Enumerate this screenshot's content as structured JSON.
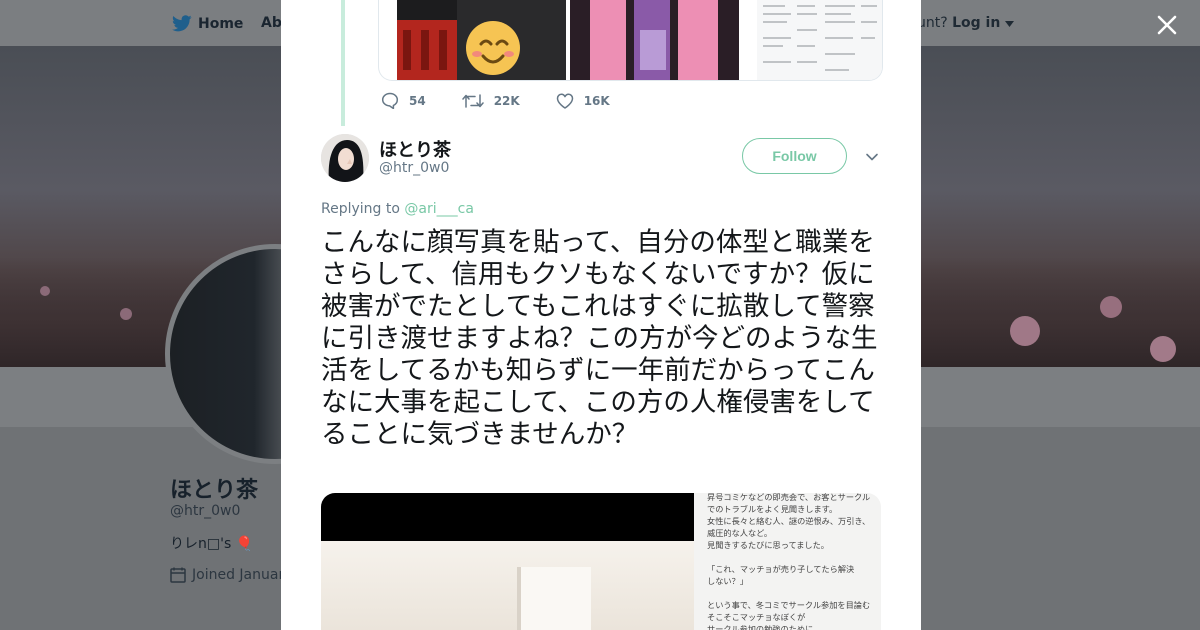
{
  "background_page": {
    "nav": {
      "home_label": "Home",
      "about_label": "Abo",
      "account_prompt": "ccount?",
      "login_label": "Log in"
    },
    "profile": {
      "name": "ほとり茶",
      "handle": "@htr_0w0",
      "bio": "りレn□'s 🎈",
      "joined": "Joined Januar"
    }
  },
  "modal": {
    "quoted_tweet": {
      "reply_count": "54",
      "retweet_count": "22K",
      "like_count": "16K",
      "media_count": 3
    },
    "tweet": {
      "author_name": "ほとり茶",
      "author_handle": "@htr_0w0",
      "follow_label": "Follow",
      "replying_prefix": "Replying to",
      "replying_to": "@ari___ca",
      "text": "こんなに顔写真を貼って、自分の体型と職業をさらして、信用もクソもなくないですか？仮に被害がでたとしてもこれはすぐに拡散して警察に引き渡せますよね？この方が今どのような生活をしてるかも知らずに一年前だからってこんなに大事を起こして、この方の人権侵害をしてることに気づきませんか？",
      "media_note_text": "昇号コミケなどの即売会で、お客とサークル\nでのトラブルをよく見聞きします。\n女性に長々と絡む人、謎の逆恨み、万引き、\n威圧的な人など。\n見聞きするたびに思ってました。\n\n「これ、マッチョが売り子してたら解決\nしない？」\n\nという事で、冬コミでサークル参加を目論む\nそこそこマッチョなぼくが\nサークル参加の勉強のために"
    }
  },
  "colors": {
    "accent_green": "#79c8a6",
    "thread_line": "#c8ecdc",
    "text_primary": "#14171a",
    "text_secondary": "#657786"
  },
  "icons": [
    "twitter-bird-icon",
    "close-icon",
    "reply-icon",
    "retweet-icon",
    "like-icon",
    "chevron-down-icon",
    "calendar-icon"
  ]
}
